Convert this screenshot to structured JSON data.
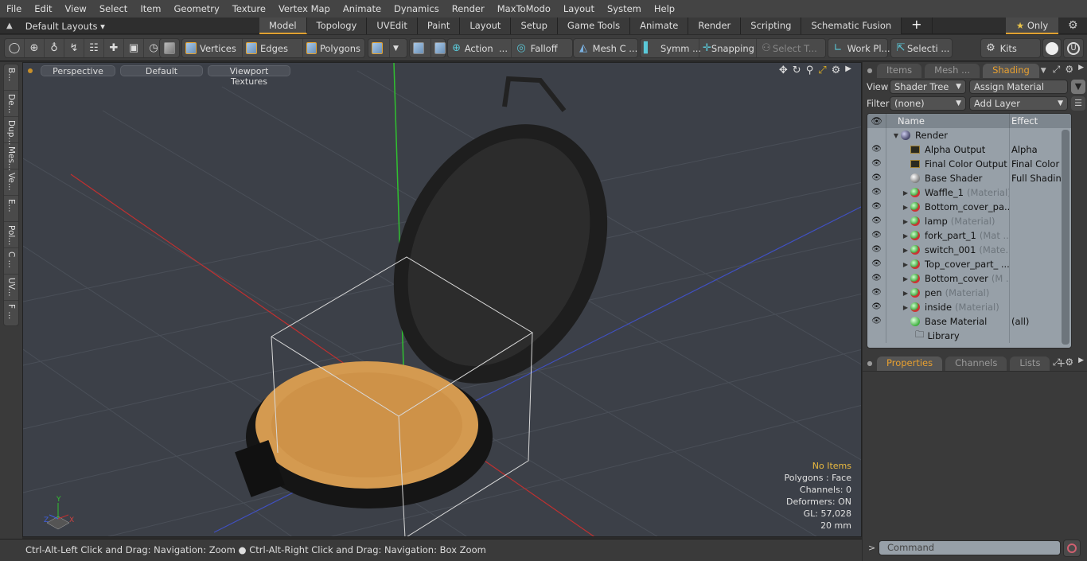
{
  "menu": [
    "File",
    "Edit",
    "View",
    "Select",
    "Item",
    "Geometry",
    "Texture",
    "Vertex Map",
    "Animate",
    "Dynamics",
    "Render",
    "MaxToModo",
    "Layout",
    "System",
    "Help"
  ],
  "layout_selector": "Default Layouts ▾",
  "tabs": [
    {
      "label": "Model",
      "active": true
    },
    {
      "label": "Topology"
    },
    {
      "label": "UVEdit"
    },
    {
      "label": "Paint"
    },
    {
      "label": "Layout"
    },
    {
      "label": "Setup"
    },
    {
      "label": "Game Tools"
    },
    {
      "label": "Animate"
    },
    {
      "label": "Render"
    },
    {
      "label": "Scripting"
    },
    {
      "label": "Schematic Fusion"
    }
  ],
  "only_button": "Only",
  "toolbar": {
    "vertices": "Vertices",
    "edges": "Edges",
    "polygons": "Polygons",
    "action": "Action",
    "action_more": "...",
    "falloff": "Falloff",
    "mesh_c": "Mesh C ...",
    "symm": "Symm ...",
    "snapping": "Snapping",
    "select_t": "Select T...",
    "work_pl": "Work Pl...",
    "selecti": "Selecti ...",
    "kits": "Kits"
  },
  "left_strip": [
    "B...",
    "De...",
    "Dup...",
    "Mes...",
    "Ve...",
    "E...",
    "Pol...",
    "C ...",
    "UV...",
    "F ..."
  ],
  "viewport": {
    "view": "Perspective",
    "style": "Default",
    "textures": "Viewport Textures",
    "info": {
      "items": "No Items",
      "polygons": "Polygons : Face",
      "channels": "Channels: 0",
      "deformers": "Deformers: ON",
      "gl": "GL: 57,028",
      "scale": "20 mm"
    },
    "axes": {
      "x": "X",
      "y": "Y",
      "z": "Z"
    }
  },
  "status": "Ctrl-Alt-Left Click and Drag: Navigation: Zoom ● Ctrl-Alt-Right Click and Drag: Navigation: Box Zoom",
  "right_panel": {
    "tabs": [
      {
        "label": "Items"
      },
      {
        "label": "Mesh ..."
      },
      {
        "label": "Shading",
        "active": true
      }
    ],
    "view_label": "View",
    "view_value": "Shader Tree",
    "assign": "Assign Material",
    "filter_label": "Filter",
    "filter_value": "(none)",
    "add_layer": "Add Layer",
    "col_name": "Name",
    "col_effect": "Effect",
    "tree": [
      {
        "name": "Render",
        "sub": "",
        "effect": "",
        "kind": "blue",
        "level": 0,
        "eye": false,
        "dd": false
      },
      {
        "name": "Alpha Output",
        "sub": "",
        "effect": "Alpha",
        "kind": "out",
        "level": 1,
        "eye": true,
        "dd": true
      },
      {
        "name": "Final Color Output",
        "sub": "",
        "effect": "Final Color",
        "kind": "out",
        "level": 1,
        "eye": true,
        "dd": true
      },
      {
        "name": "Base Shader",
        "sub": "",
        "effect": "Full Shading",
        "kind": "white",
        "level": 1,
        "eye": true,
        "dd": true
      },
      {
        "name": "Waffle_1",
        "sub": "(Material)",
        "effect": "",
        "kind": "mat",
        "level": 1,
        "eye": true,
        "dd": true,
        "exp": true
      },
      {
        "name": "Bottom_cover_pa...",
        "sub": "",
        "effect": "",
        "kind": "mat",
        "level": 1,
        "eye": true,
        "dd": true,
        "exp": true
      },
      {
        "name": "lamp",
        "sub": "(Material)",
        "effect": "",
        "kind": "mat",
        "level": 1,
        "eye": true,
        "dd": true,
        "exp": true
      },
      {
        "name": "fork_part_1",
        "sub": "(Mat ...",
        "effect": "",
        "kind": "mat",
        "level": 1,
        "eye": true,
        "dd": true,
        "exp": true
      },
      {
        "name": "switch_001",
        "sub": "(Mate...",
        "effect": "",
        "kind": "mat",
        "level": 1,
        "eye": true,
        "dd": true,
        "exp": true
      },
      {
        "name": "Top_cover_part_ ...",
        "sub": "",
        "effect": "",
        "kind": "mat",
        "level": 1,
        "eye": true,
        "dd": true,
        "exp": true
      },
      {
        "name": "Bottom_cover",
        "sub": "(M ...",
        "effect": "",
        "kind": "mat",
        "level": 1,
        "eye": true,
        "dd": true,
        "exp": true
      },
      {
        "name": "pen",
        "sub": "(Material)",
        "effect": "",
        "kind": "mat",
        "level": 1,
        "eye": true,
        "dd": true,
        "exp": true
      },
      {
        "name": "inside",
        "sub": "(Material)",
        "effect": "",
        "kind": "mat",
        "level": 1,
        "eye": true,
        "dd": true,
        "exp": true
      },
      {
        "name": "Base Material",
        "sub": "",
        "effect": "(all)",
        "kind": "green",
        "level": 1,
        "eye": true,
        "dd": true
      },
      {
        "name": "Library",
        "sub": "",
        "effect": "",
        "kind": "folder",
        "level": 0,
        "eye": false,
        "dd": false
      }
    ],
    "bottom_tabs": [
      {
        "label": "Properties",
        "active": true
      },
      {
        "label": "Channels"
      },
      {
        "label": "Lists"
      }
    ],
    "command_placeholder": "Command"
  }
}
